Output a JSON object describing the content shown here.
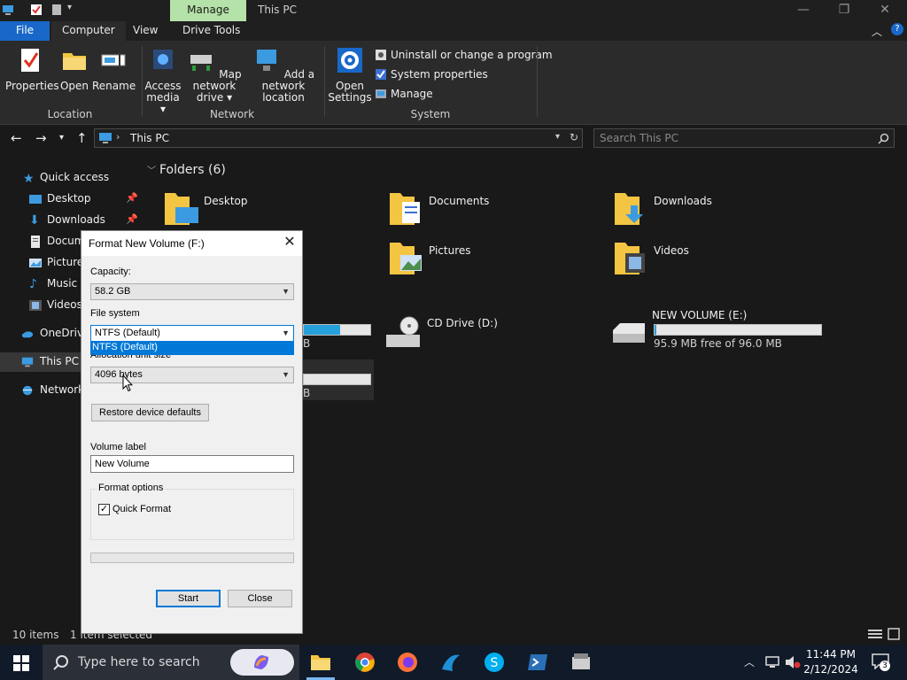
{
  "titlebar": {
    "context_tab": "Manage",
    "title": "This PC",
    "minimize": "—",
    "maximize": "❐",
    "close": "✕"
  },
  "ribbon_tabs": {
    "file": "File",
    "computer": "Computer",
    "view": "View",
    "drive_tools": "Drive Tools"
  },
  "ribbon": {
    "location": {
      "properties": "Properties",
      "open": "Open",
      "rename": "Rename",
      "label": "Location"
    },
    "network": {
      "access_media_1": "Access",
      "access_media_2": "media ▾",
      "map_drive_1": "Map network",
      "map_drive_2": "drive ▾",
      "add_location_1": "Add a network",
      "add_location_2": "location",
      "label": "Network"
    },
    "system": {
      "open_settings_1": "Open",
      "open_settings_2": "Settings",
      "uninstall": "Uninstall or change a program",
      "system_properties": "System properties",
      "manage": "Manage",
      "label": "System"
    }
  },
  "address": {
    "path": "This PC",
    "search_placeholder": "Search This PC"
  },
  "nav": {
    "items": [
      {
        "label": "Quick access"
      },
      {
        "label": "Desktop"
      },
      {
        "label": "Downloads"
      },
      {
        "label": "Documents"
      },
      {
        "label": "Pictures"
      },
      {
        "label": "Music"
      },
      {
        "label": "Videos"
      },
      {
        "label": "OneDrive"
      },
      {
        "label": "This PC"
      },
      {
        "label": "Network"
      }
    ]
  },
  "content": {
    "folders_heading": "Folders (6)",
    "folders": [
      {
        "label": "Desktop"
      },
      {
        "label": "Documents"
      },
      {
        "label": "Downloads"
      },
      {
        "label": "Pictures"
      },
      {
        "label": "Videos"
      }
    ],
    "drives": [
      {
        "label": "CD Drive (D:)"
      },
      {
        "label": "NEW VOLUME (E:)",
        "free": "95.9 MB free of 96.0 MB",
        "used_fraction": 0.01
      }
    ],
    "partial": {
      "c_drive_fragment": "B",
      "f_drive_fragment": "B",
      "c_drive_used_fraction": 0.55
    }
  },
  "statusbar": {
    "items": "10 items",
    "selected": "1 item selected"
  },
  "taskbar": {
    "search_placeholder": "Type here to search",
    "time": "11:44 PM",
    "date": "2/12/2024",
    "notifications": "3"
  },
  "dialog": {
    "title": "Format New Volume (F:)",
    "close": "✕",
    "capacity_label": "Capacity:",
    "capacity_value": "58.2 GB",
    "filesystem_label": "File system",
    "filesystem_value": "NTFS (Default)",
    "filesystem_option": "NTFS (Default)",
    "allocation_label": "Allocation unit size",
    "allocation_value": "4096 bytes",
    "restore_button": "Restore device defaults",
    "volume_label_label": "Volume label",
    "volume_label_value": "New Volume",
    "format_options_label": "Format options",
    "quick_format_label": "Quick Format",
    "quick_format_checked": "✓",
    "start_button": "Start",
    "close_button": "Close"
  }
}
